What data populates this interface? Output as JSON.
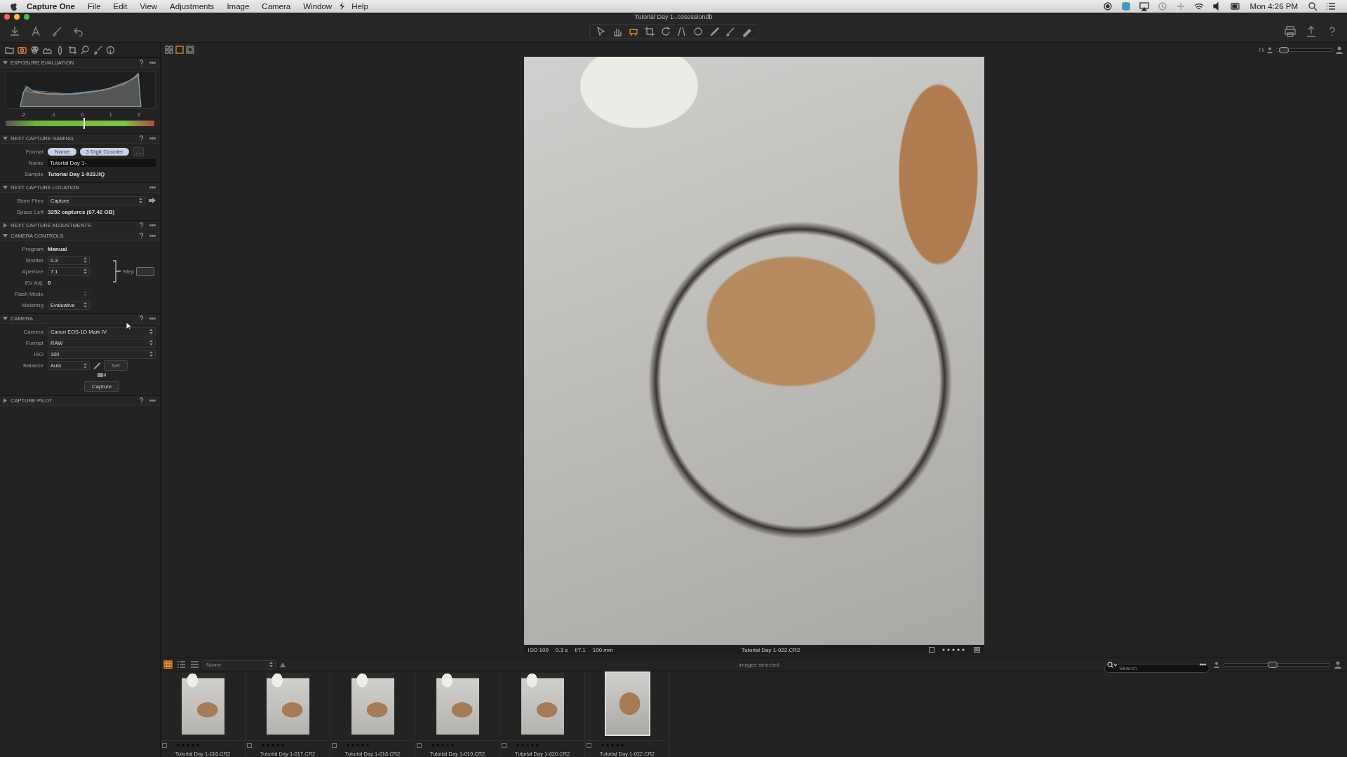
{
  "menu_bar": {
    "app": "Capture One",
    "items": [
      "File",
      "Edit",
      "View",
      "Adjustments",
      "Image",
      "Camera",
      "Window"
    ],
    "help": "Help",
    "clock": "Mon 4:26 PM"
  },
  "window": {
    "title": "Tutorial Day 1-.cosessiondb"
  },
  "cursor_tools": [
    {
      "selected": false
    },
    {
      "selected": false
    },
    {
      "selected": true
    },
    {
      "selected": false
    },
    {
      "selected": false
    },
    {
      "selected": false
    },
    {
      "selected": false
    },
    {
      "selected": false
    },
    {
      "selected": false
    },
    {
      "selected": false
    }
  ],
  "tool_tabs": [
    {
      "selected": false
    },
    {
      "selected": true
    },
    {
      "selected": false
    },
    {
      "selected": false
    },
    {
      "selected": false
    },
    {
      "selected": false
    },
    {
      "selected": false
    },
    {
      "selected": false
    },
    {
      "selected": false
    }
  ],
  "viewer_modes": [
    {
      "selected": false
    },
    {
      "selected": true
    },
    {
      "selected": false
    }
  ],
  "panels": [
    {
      "title": "EXPOSURE EVALUATION",
      "expanded": true,
      "help": true,
      "kind": "exposure",
      "scale": [
        "-2",
        "-1",
        "0",
        "1",
        "2"
      ],
      "level": 0.53
    },
    {
      "title": "NEXT CAPTURE NAMING",
      "expanded": true,
      "help": true,
      "kind": "form",
      "rows": [
        {
          "kind": "tokens",
          "label": "Format",
          "tokens": [
            "Name",
            "3 Digit Counter"
          ],
          "more": "…"
        },
        {
          "kind": "input",
          "label": "Name",
          "value": "Tutorial Day 1-"
        },
        {
          "kind": "text",
          "label": "Sample",
          "value": "Tutorial Day 1-023.IIQ"
        }
      ]
    },
    {
      "title": "NEXT CAPTURE LOCATION",
      "expanded": true,
      "help": false,
      "kind": "form",
      "rows": [
        {
          "kind": "select",
          "label": "Store Files",
          "value": "Capture",
          "wide": true,
          "go": true
        },
        {
          "kind": "text",
          "label": "Space Left",
          "value": "3252 captures (67.42 GB)"
        }
      ]
    },
    {
      "title": "NEXT CAPTURE ADJUSTMENTS",
      "expanded": false,
      "help": true
    },
    {
      "title": "CAMERA CONTROLS",
      "expanded": true,
      "help": true,
      "kind": "form",
      "step": {
        "label": "Step"
      },
      "rows": [
        {
          "kind": "text",
          "label": "Program",
          "value": "Manual"
        },
        {
          "kind": "select",
          "label": "Shutter",
          "value": "0.3"
        },
        {
          "kind": "select",
          "label": "Aperture",
          "value": "7.1"
        },
        {
          "kind": "text",
          "label": "EV Adj.",
          "value": "0"
        },
        {
          "kind": "select",
          "label": "Flash Mode",
          "disabled": true
        },
        {
          "kind": "select",
          "label": "Metering",
          "value": "Evaluative"
        }
      ]
    },
    {
      "title": "CAMERA",
      "expanded": true,
      "help": true,
      "kind": "form",
      "rows": [
        {
          "kind": "select",
          "label": "Camera",
          "value": "Canon EOS-1D Mark IV",
          "wide": true
        },
        {
          "kind": "select",
          "label": "Format",
          "value": "RAW",
          "wide": true
        },
        {
          "kind": "select",
          "label": "ISO",
          "value": "100",
          "wide": true
        },
        {
          "kind": "balance",
          "label": "Balance",
          "value": "Auto",
          "set": "Set"
        },
        {
          "kind": "capture",
          "button": "Capture"
        }
      ]
    },
    {
      "title": "CAPTURE PILOT",
      "expanded": false,
      "help": true
    }
  ],
  "viewer": {
    "zoom": {
      "label": "Fit",
      "level": 0.12
    },
    "info": [
      "ISO 100",
      "0.3 s",
      "f/7.1",
      "100 mm"
    ],
    "filename": "Tutorial Day 1-022.CR2"
  },
  "browser": {
    "views": [
      {
        "selected": true
      },
      {
        "selected": false
      },
      {
        "selected": false
      }
    ],
    "sort": "Name",
    "selection": "images selected",
    "search": {
      "placeholder": "Search"
    },
    "size": {
      "level": 0.45
    },
    "thumbnails": [
      {
        "label": "Tutorial Day 1-016.CR2",
        "selected": false
      },
      {
        "label": "Tutorial Day 1-017.CR2",
        "selected": false
      },
      {
        "label": "Tutorial Day 1-018.CR2",
        "selected": false
      },
      {
        "label": "Tutorial Day 1-019.CR2",
        "selected": false
      },
      {
        "label": "Tutorial Day 1-020.CR2",
        "selected": false
      },
      {
        "label": "Tutorial Day 1-022.CR2",
        "selected": true
      }
    ]
  }
}
